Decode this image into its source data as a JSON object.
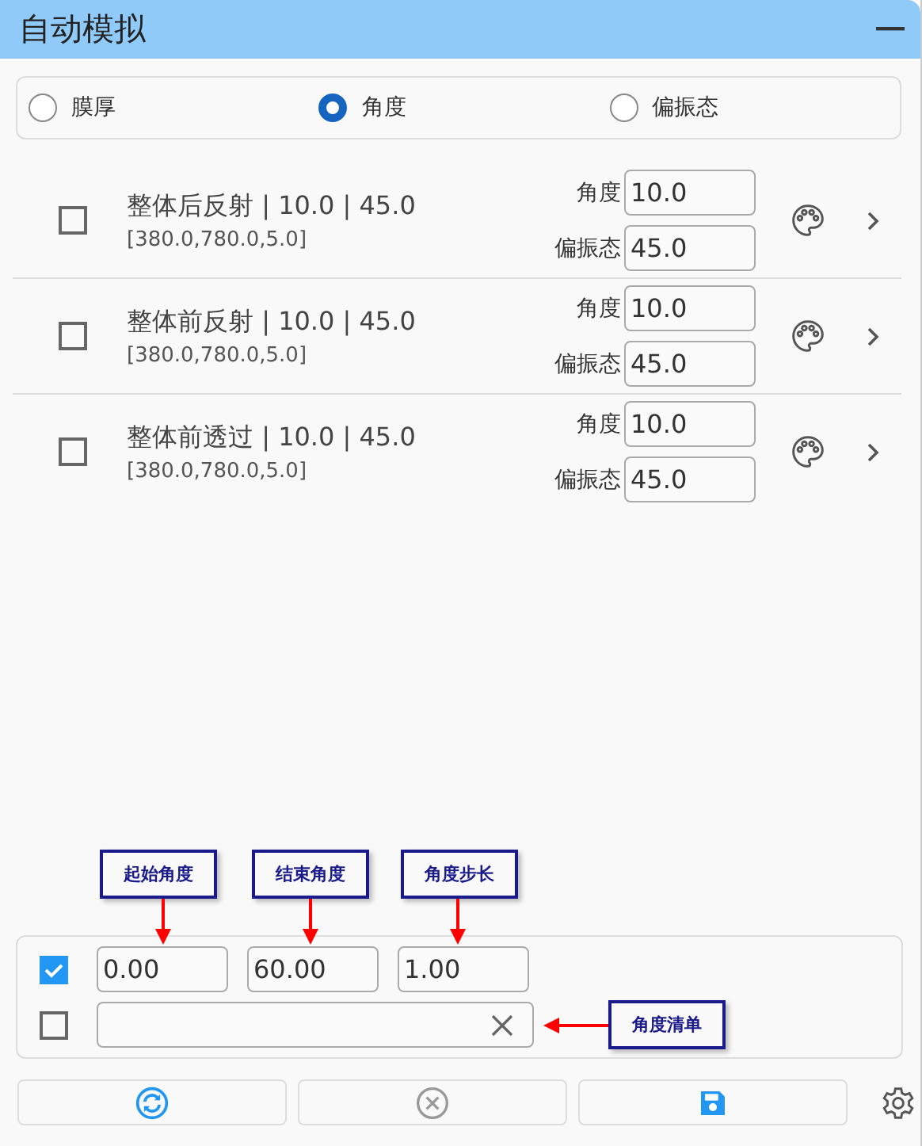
{
  "window": {
    "title": "自动模拟"
  },
  "modes": [
    {
      "label": "膜厚",
      "selected": false
    },
    {
      "label": "角度",
      "selected": true
    },
    {
      "label": "偏振态",
      "selected": false
    }
  ],
  "items": [
    {
      "checked": false,
      "title": "整体后反射 | 10.0 | 45.0",
      "range": "[380.0,780.0,5.0]",
      "fields": [
        {
          "label": "角度",
          "value": "10.0"
        },
        {
          "label": "偏振态",
          "value": "45.0"
        }
      ]
    },
    {
      "checked": false,
      "title": "整体前反射 | 10.0 | 45.0",
      "range": "[380.0,780.0,5.0]",
      "fields": [
        {
          "label": "角度",
          "value": "10.0"
        },
        {
          "label": "偏振态",
          "value": "45.0"
        }
      ]
    },
    {
      "checked": false,
      "title": "整体前透过 | 10.0 | 45.0",
      "range": "[380.0,780.0,5.0]",
      "fields": [
        {
          "label": "角度",
          "value": "10.0"
        },
        {
          "label": "偏振态",
          "value": "45.0"
        }
      ]
    }
  ],
  "range_row": {
    "checked": true,
    "values": [
      "0.00",
      "60.00",
      "1.00"
    ]
  },
  "list_row": {
    "checked": false
  },
  "annotations": [
    "起始角度",
    "结束角度",
    "角度步长",
    "角度清单"
  ]
}
